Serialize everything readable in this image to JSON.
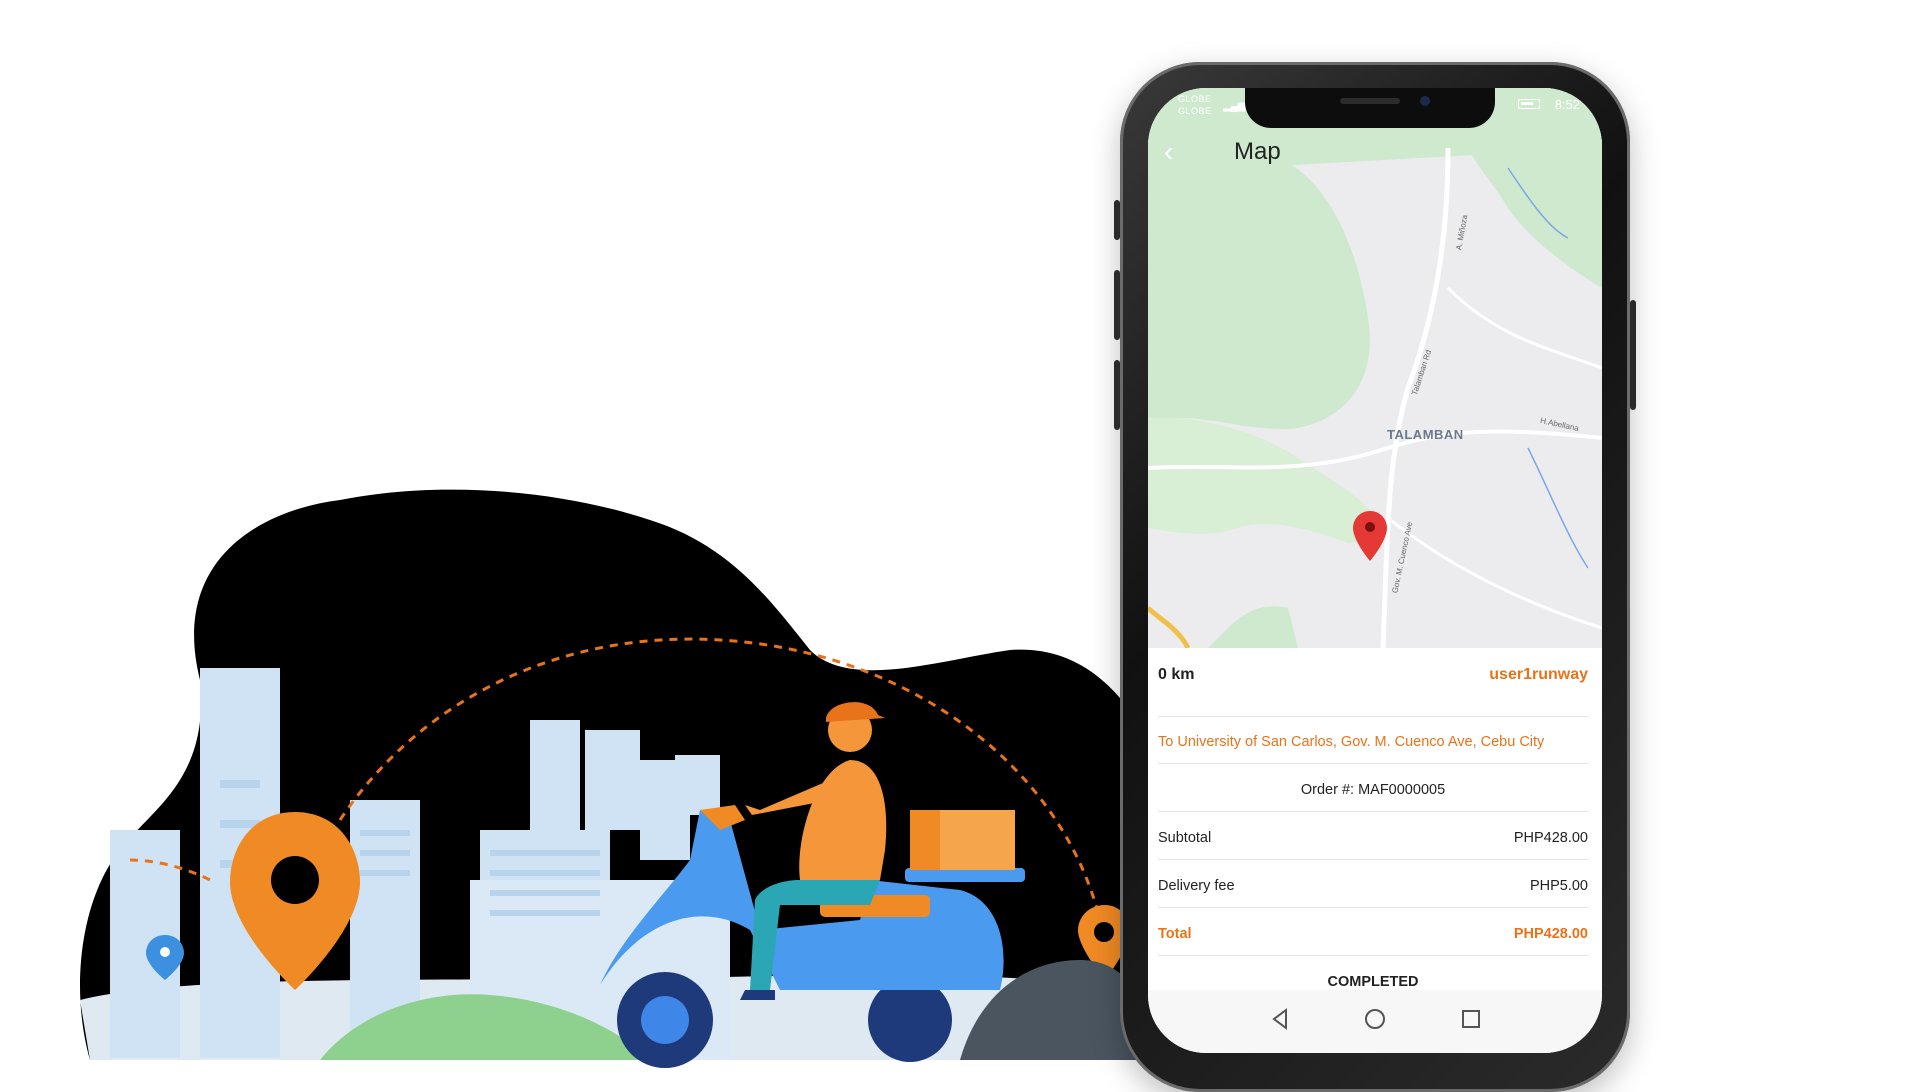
{
  "illustration": {
    "description_icons": [
      "location-pin-icon",
      "delivery-scooter",
      "city-buildings",
      "parcel-box"
    ]
  },
  "phone": {
    "status": {
      "carrier_1": "GLOBE",
      "carrier_2": "GLOBE",
      "time": "8:52"
    },
    "header": {
      "title": "Map",
      "back_icon": "chevron-left-icon"
    },
    "map": {
      "place_label": "TALAMBAN",
      "roads": [
        "A. Miñoza",
        "Talamban Rd",
        "H.Abellana",
        "Gov. M. Cuenco Ave"
      ],
      "marker_icon": "map-pin-icon"
    },
    "details": {
      "distance": "0 km",
      "username": "user1runway",
      "destination": "To University of San Carlos, Gov. M. Cuenco Ave, Cebu City",
      "order_number": "Order #: MAF0000005",
      "subtotal_label": "Subtotal",
      "subtotal_value": "PHP428.00",
      "delivery_label": "Delivery fee",
      "delivery_value": "PHP5.00",
      "total_label": "Total",
      "total_value": "PHP428.00",
      "status": "COMPLETED"
    },
    "nav": {
      "back": "triangle-back-icon",
      "home": "circle-home-icon",
      "recents": "square-recents-icon"
    }
  },
  "colors": {
    "accent": "#e8731a",
    "map_green": "#cfe9cf",
    "map_gray": "#ececef"
  }
}
